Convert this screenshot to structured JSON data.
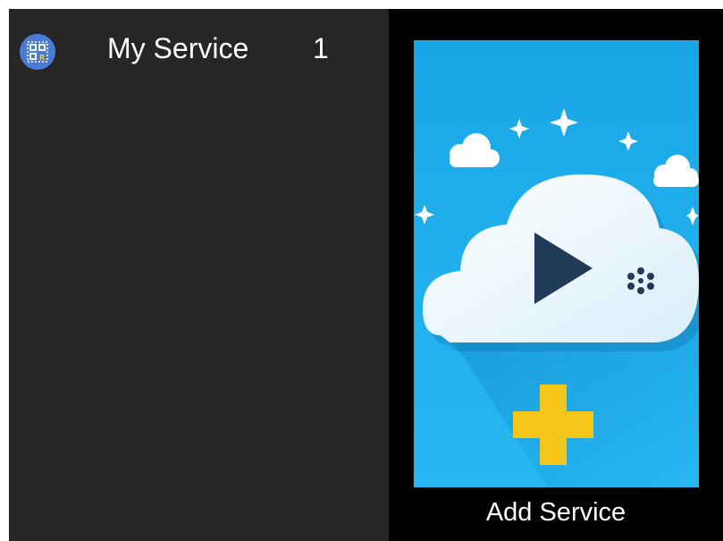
{
  "services": [
    {
      "name": "My Service",
      "count": "1",
      "icon": "qr-code-icon"
    }
  ],
  "add_service": {
    "label": "Add Service",
    "icon": "cloud-play-add-icon"
  },
  "colors": {
    "left_panel_bg": "#262626",
    "right_panel_bg": "#000000",
    "tile_bg": "#1eb0ee",
    "cloud": "#ffffff",
    "play": "#1f3b57",
    "plus": "#f5c518",
    "app_icon_bg": "#4a7cd6"
  }
}
